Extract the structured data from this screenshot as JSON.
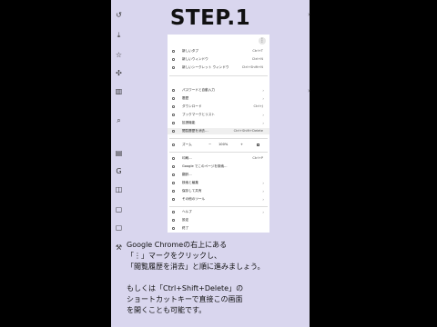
{
  "title": "STEP.1",
  "menu": {
    "kebab": "⋮",
    "items": [
      {
        "label": "新しいタブ",
        "shortcut": "Ctrl+T"
      },
      {
        "label": "新しいウィンドウ",
        "shortcut": "Ctrl+N"
      },
      {
        "label": "新しいシークレット ウィンドウ",
        "shortcut": "Ctrl+Shift+N"
      },
      {
        "label": "パスワードと自動入力",
        "arrow": "›"
      },
      {
        "label": "履歴",
        "arrow": "›"
      },
      {
        "label": "ダウンロード",
        "shortcut": "Ctrl+J"
      },
      {
        "label": "ブックマークとリスト",
        "arrow": "›"
      },
      {
        "label": "拡張機能",
        "arrow": "›"
      },
      {
        "label": "閲覧履歴を消去...",
        "shortcut": "Ctrl+Shift+Delete"
      },
      {
        "label": "印刷...",
        "shortcut": "Ctrl+P"
      },
      {
        "label": "Google でこのページを検索..."
      },
      {
        "label": "翻訳..."
      },
      {
        "label": "検索と編集",
        "arrow": "›"
      },
      {
        "label": "保存して共有",
        "arrow": "›"
      },
      {
        "label": "その他のツール",
        "arrow": "›"
      },
      {
        "label": "ヘルプ",
        "arrow": "›"
      },
      {
        "label": "設定"
      },
      {
        "label": "終了"
      }
    ],
    "zoom": {
      "label": "ズーム",
      "minus": "−",
      "value": "100%",
      "plus": "+"
    }
  },
  "instructions": [
    "Google Chromeの右上にある",
    "「⋮」マークをクリックし、",
    "「閲覧履歴を消去」と順に進みましょう。",
    "",
    "もしくは「Ctrl+Shift+Delete」の",
    "ショートカットキーで直接この画面",
    "を開くことも可能です。"
  ],
  "side_icons": [
    "history-icon",
    "download-icon",
    "bookmark-icon",
    "extensions-icon",
    "delete-icon",
    "zoom-icon",
    "print-icon",
    "google-icon",
    "translate-icon",
    "search-edit-icon",
    "save-share-icon",
    "more-tools-icon"
  ]
}
